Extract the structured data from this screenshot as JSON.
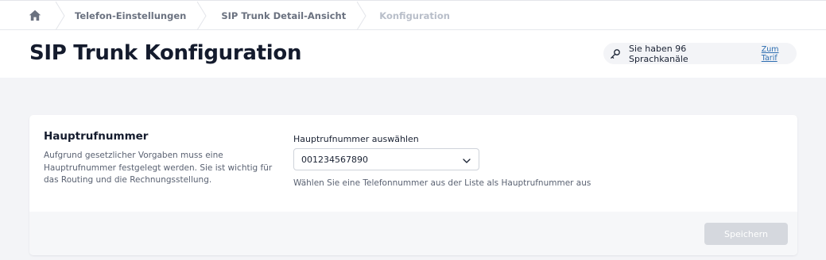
{
  "breadcrumb": {
    "items": [
      {
        "label": "Telefon-Einstellungen"
      },
      {
        "label": "SIP Trunk Detail-Ansicht"
      },
      {
        "label": "Konfiguration"
      }
    ]
  },
  "header": {
    "title": "SIP Trunk Konfiguration",
    "channels_text": "Sie haben 96 Sprachkanäle",
    "tariff_link": "Zum Tarif"
  },
  "card": {
    "title": "Hauptrufnummer",
    "description": "Aufgrund gesetzlicher Vorgaben muss eine Hauptrufnummer festgelegt werden. Sie ist wichtig für das Routing und die Rechnungsstellung.",
    "field_label": "Hauptrufnummer auswählen",
    "selected_number": "001234567890",
    "hint": "Wählen Sie eine Telefonnummer aus der Liste als Hauptrufnummer aus",
    "save_label": "Speichern"
  },
  "colors": {
    "accent_link": "#2b6cb0",
    "disabled_button": "#d5d8de",
    "background": "#f3f4f7"
  },
  "icons": {
    "home": "home-icon",
    "key": "key-icon",
    "chevron": "chevron-down-icon"
  }
}
